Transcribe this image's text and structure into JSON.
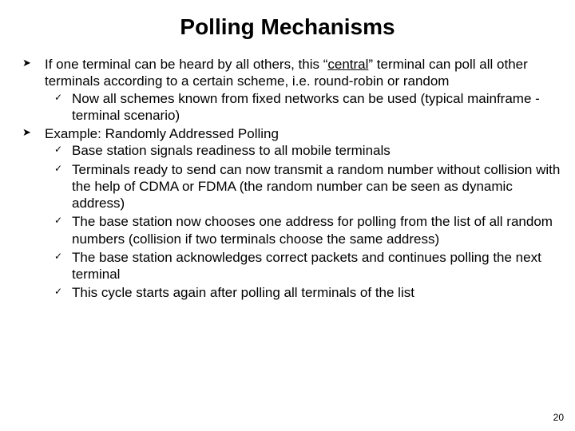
{
  "title": "Polling Mechanisms",
  "bullets": [
    {
      "pre": "If one terminal can be heard by all others, this “",
      "u": "central",
      "post": "” terminal can poll all other terminals according to a certain scheme, i.e. round-robin or random",
      "sub": [
        "Now all schemes known from fixed networks can be used (typical mainframe - terminal scenario)"
      ]
    },
    {
      "pre": "Example: Randomly Addressed Polling",
      "u": "",
      "post": "",
      "sub": [
        "Base station signals readiness to all mobile terminals",
        "Terminals ready to send can now transmit a random number without collision with the help of CDMA or FDMA (the random number can be seen as dynamic address)",
        "The base station now chooses one address for polling from the list of all random numbers (collision if two terminals choose the same address)",
        "The base station acknowledges correct packets and continues polling the next terminal",
        "This cycle starts again after polling all terminals of the list"
      ]
    }
  ],
  "pagenum": "20"
}
